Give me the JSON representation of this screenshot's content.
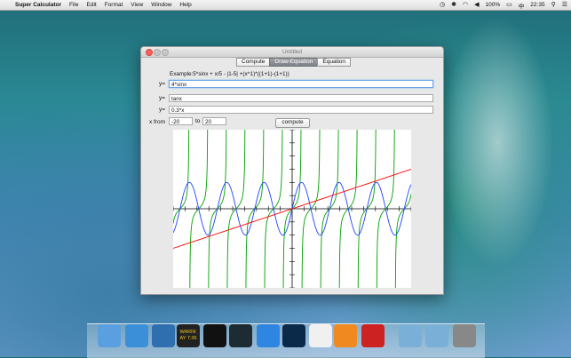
{
  "menubar": {
    "app_name": "Super Calculator",
    "items": [
      "File",
      "Edit",
      "Format",
      "View",
      "Window",
      "Help"
    ],
    "battery": "100%",
    "input_source": "中",
    "clock": "22:35"
  },
  "window": {
    "title": "Untitled",
    "tabs": [
      {
        "label": "Compute",
        "active": false
      },
      {
        "label": "Draw-Equation",
        "active": true
      },
      {
        "label": "Equation",
        "active": false
      }
    ],
    "example": "Example:5*sinx + x/5 - |1-5| +(x^1)*((1+1)-(1+1))",
    "equations": [
      {
        "label": "y=",
        "value": "4*sinx",
        "color": "#1f3fff"
      },
      {
        "label": "y=",
        "value": "tanx",
        "color": "#00a000"
      },
      {
        "label": "y=",
        "value": "0.3*x",
        "color": "#ff0000"
      }
    ],
    "x_from_label": "x from",
    "x_from": "-20",
    "to_label": "to",
    "x_to": "20",
    "compute_label": "compute"
  },
  "chart_data": {
    "type": "line",
    "xlim": [
      -20,
      20
    ],
    "ylim": [
      -12,
      12
    ],
    "grid": false,
    "series": [
      {
        "formula": "4*sinx",
        "color": "#1f3fff"
      },
      {
        "formula": "tanx",
        "color": "#00a000"
      },
      {
        "formula": "0.3*x",
        "color": "#ff0000"
      }
    ]
  },
  "dock": {
    "items": [
      "finder-icon",
      "safari-icon",
      "xcode-icon",
      "console-icon",
      "terminal-icon",
      "activity-monitor-icon",
      "app-store-icon",
      "photoshop-icon",
      "preview-icon",
      "ibooks-icon",
      "super-calculator-icon",
      "documents-folder-icon",
      "downloads-folder-icon",
      "trash-icon"
    ],
    "console_text": "WARNI\nAY 7:36"
  }
}
